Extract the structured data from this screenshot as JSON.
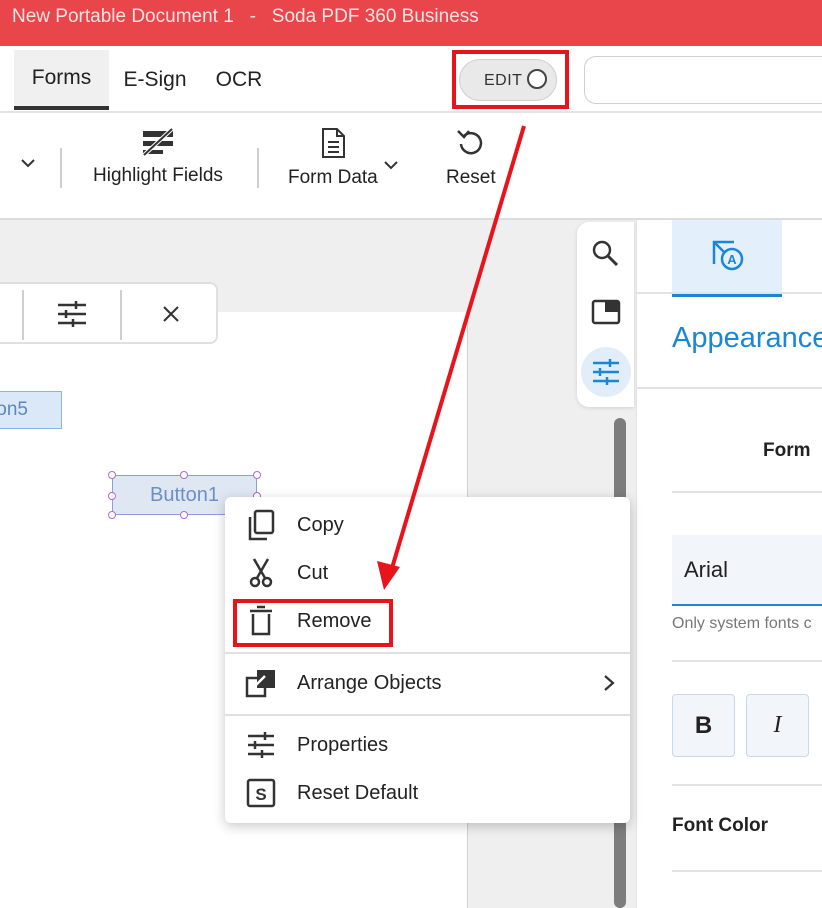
{
  "window": {
    "title": "New Portable Document 1   -   Soda PDF 360 Business",
    "title_color": "#e8464b"
  },
  "tabs": [
    {
      "label": "Forms",
      "active": true
    },
    {
      "label": "E-Sign",
      "active": false
    },
    {
      "label": "OCR",
      "active": false
    }
  ],
  "edit_toggle": {
    "label": "EDIT",
    "on": false
  },
  "ribbon": {
    "highlight_fields": "Highlight Fields",
    "form_data": "Form Data",
    "reset": "Reset"
  },
  "document": {
    "field5_label": "on5",
    "button1_label": "Button1"
  },
  "context_menu": {
    "copy": "Copy",
    "cut": "Cut",
    "remove": "Remove",
    "arrange_objects": "Arrange Objects",
    "properties": "Properties",
    "reset_default": "Reset Default"
  },
  "right_panel": {
    "heading": "Appearance",
    "form_label": "Form",
    "font_value": "Arial",
    "font_hint": "Only system fonts c",
    "bold": "B",
    "italic": "I",
    "font_color_label": "Font Color"
  },
  "colors": {
    "accent_blue": "#1a86d6",
    "annotation_red": "#e8141c"
  }
}
